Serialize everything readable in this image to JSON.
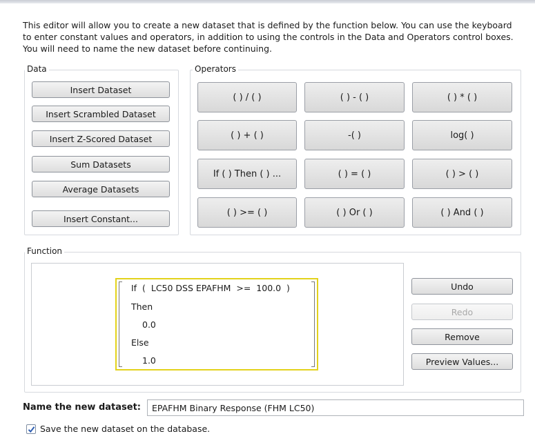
{
  "intro_text": "This editor will allow you to create a new dataset that is defined by the function below. You can use the keyboard to enter constant values and operators, in addition to using the controls in the Data and Operators control boxes. You will need to name the new dataset before continuing.",
  "data_group": {
    "label": "Data",
    "buttons": [
      "Insert Dataset",
      "Insert Scrambled Dataset",
      "Insert Z-Scored Dataset",
      "Sum Datasets",
      "Average Datasets",
      "Insert Constant..."
    ]
  },
  "operators_group": {
    "label": "Operators",
    "buttons": [
      "( ) / ( )",
      "( ) - ( )",
      "( ) * ( )",
      "( ) + ( )",
      "-( )",
      "log( )",
      "If ( ) Then ( ) ...",
      "( ) = ( )",
      "( ) > ( )",
      "( ) >= ( )",
      "( ) Or ( )",
      "( ) And ( )"
    ]
  },
  "function_group": {
    "label": "Function",
    "lines": [
      "If  (  LC50 DSS EPAFHM  >=  100.0  )",
      "Then",
      "0.0",
      "Else",
      "1.0"
    ],
    "actions": {
      "undo": "Undo",
      "redo": "Redo",
      "remove": "Remove",
      "preview": "Preview Values..."
    }
  },
  "name_label": "Name the new dataset:",
  "name_value": "EPAFHM Binary Response (FHM LC50)",
  "save_checkbox": {
    "label": "Save the new dataset on the database.",
    "checked": true
  },
  "colors": {
    "highlight_border": "#e3d21a",
    "check": "#2f5fb3"
  }
}
